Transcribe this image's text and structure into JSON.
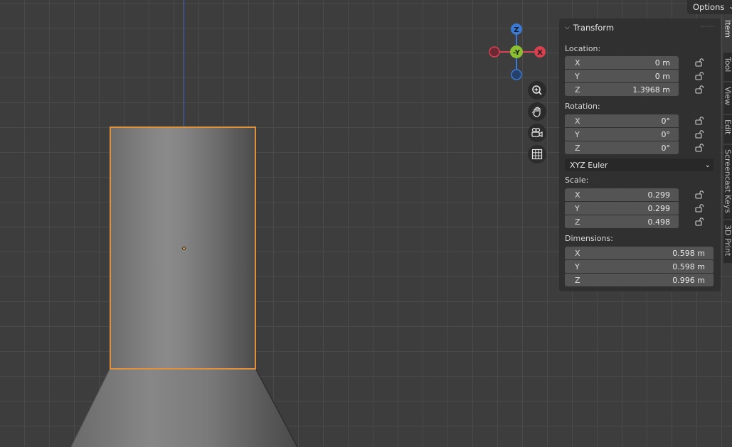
{
  "header": {
    "options_label": "Options"
  },
  "tabs": [
    "Item",
    "Tool",
    "View",
    "Edit",
    "Screencast Keys",
    "3D Print"
  ],
  "gizmo": {
    "z": "Z",
    "y": "-Y",
    "x": "X"
  },
  "panel": {
    "title": "Transform",
    "location": {
      "label": "Location:",
      "rows": [
        {
          "axis": "X",
          "value": "0 m"
        },
        {
          "axis": "Y",
          "value": "0 m"
        },
        {
          "axis": "Z",
          "value": "1.3968 m"
        }
      ]
    },
    "rotation": {
      "label": "Rotation:",
      "rows": [
        {
          "axis": "X",
          "value": "0°"
        },
        {
          "axis": "Y",
          "value": "0°"
        },
        {
          "axis": "Z",
          "value": "0°"
        }
      ],
      "mode": "XYZ Euler"
    },
    "scale": {
      "label": "Scale:",
      "rows": [
        {
          "axis": "X",
          "value": "0.299"
        },
        {
          "axis": "Y",
          "value": "0.299"
        },
        {
          "axis": "Z",
          "value": "0.498"
        }
      ]
    },
    "dimensions": {
      "label": "Dimensions:",
      "rows": [
        {
          "axis": "X",
          "value": "0.598 m"
        },
        {
          "axis": "Y",
          "value": "0.598 m"
        },
        {
          "axis": "Z",
          "value": "0.996 m"
        }
      ]
    }
  },
  "colors": {
    "selection": "#e0913a",
    "axis_x": "#d9404f",
    "axis_y": "#8ac030",
    "axis_z": "#3a79d4"
  }
}
